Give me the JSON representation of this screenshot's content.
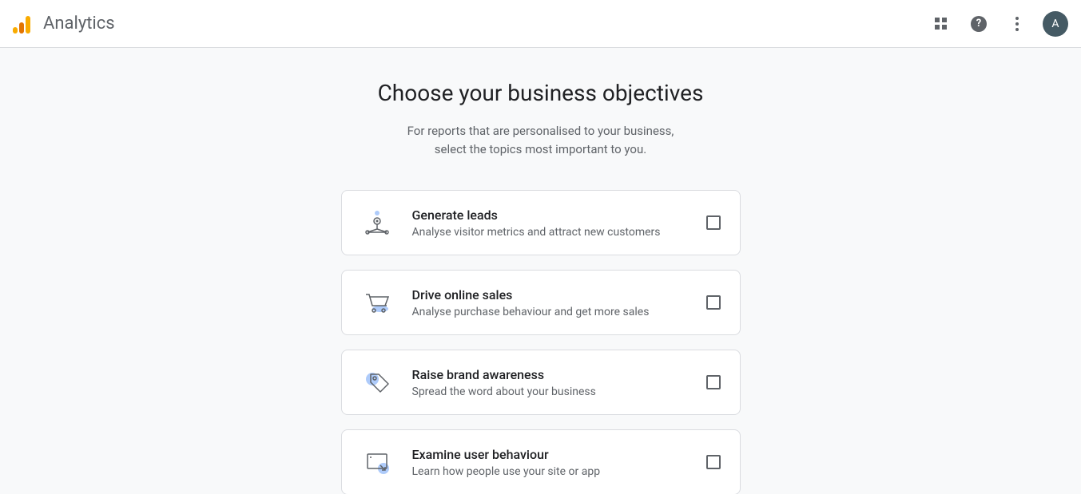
{
  "header": {
    "product": "Analytics",
    "avatar_initial": "A"
  },
  "page": {
    "title": "Choose your business objectives",
    "subtitle": "For reports that are personalised to your business,\nselect the topics most important to you."
  },
  "objectives": [
    {
      "title": "Generate leads",
      "desc": "Analyse visitor metrics and attract new customers",
      "icon": "leads"
    },
    {
      "title": "Drive online sales",
      "desc": "Analyse purchase behaviour and get more sales",
      "icon": "cart"
    },
    {
      "title": "Raise brand awareness",
      "desc": "Spread the word about your business",
      "icon": "tag"
    },
    {
      "title": "Examine user behaviour",
      "desc": "Learn how people use your site or app",
      "icon": "device"
    }
  ]
}
